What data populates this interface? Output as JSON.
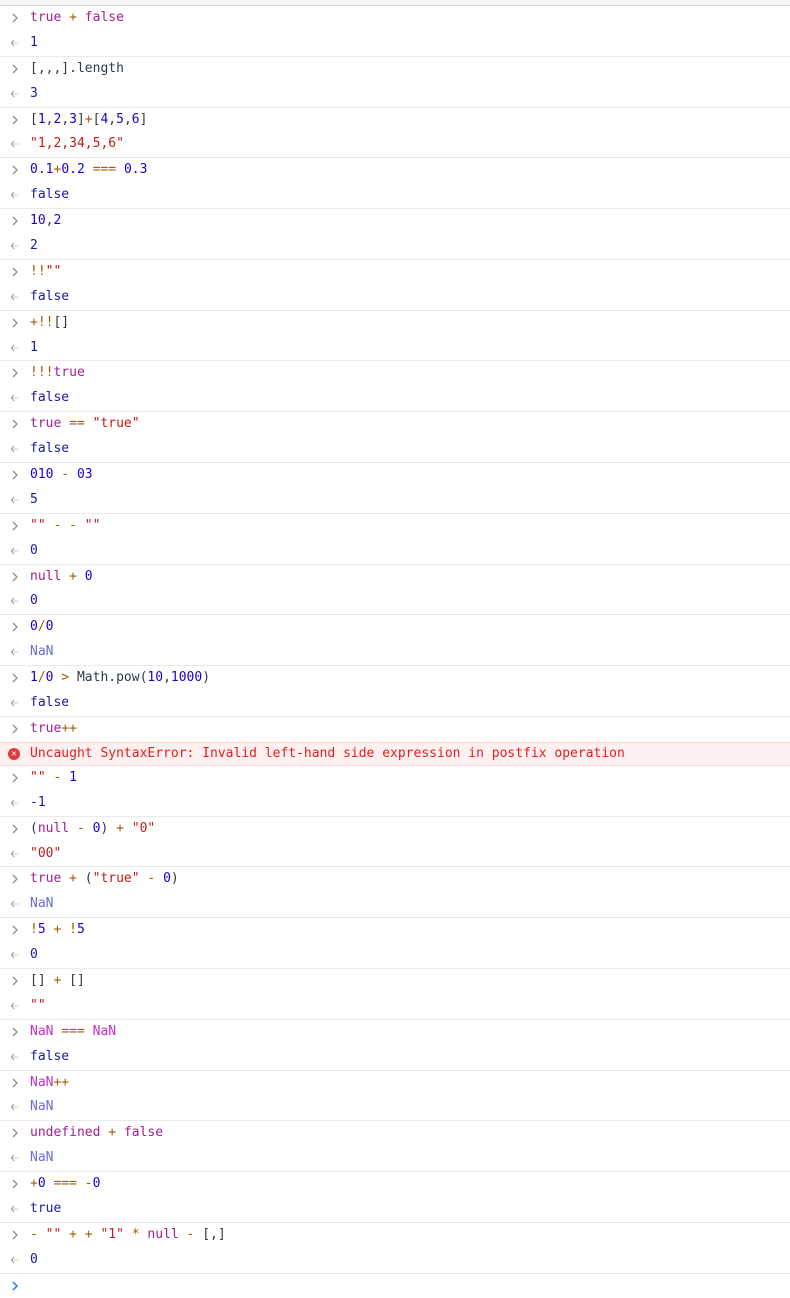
{
  "entries": [
    {
      "input": [
        [
          "kw",
          "true"
        ],
        [
          "op",
          " + "
        ],
        [
          "kw",
          "false"
        ]
      ],
      "result": [
        [
          "res",
          "1"
        ]
      ]
    },
    {
      "input": [
        [
          "ident",
          "[,,,].length"
        ]
      ],
      "result": [
        [
          "res",
          "3"
        ]
      ]
    },
    {
      "input": [
        [
          "ident",
          "["
        ],
        [
          "num",
          "1"
        ],
        [
          "ident",
          ","
        ],
        [
          "num",
          "2"
        ],
        [
          "ident",
          ","
        ],
        [
          "num",
          "3"
        ],
        [
          "ident",
          "]"
        ],
        [
          "op",
          "+"
        ],
        [
          "ident",
          "["
        ],
        [
          "num",
          "4"
        ],
        [
          "ident",
          ","
        ],
        [
          "num",
          "5"
        ],
        [
          "ident",
          ","
        ],
        [
          "num",
          "6"
        ],
        [
          "ident",
          "]"
        ]
      ],
      "result": [
        [
          "res-str",
          "\"1,2,34,5,6\""
        ]
      ]
    },
    {
      "input": [
        [
          "num",
          "0.1"
        ],
        [
          "op",
          "+"
        ],
        [
          "num",
          "0.2"
        ],
        [
          "op",
          " === "
        ],
        [
          "num",
          "0.3"
        ]
      ],
      "result": [
        [
          "res",
          "false"
        ]
      ]
    },
    {
      "input": [
        [
          "num",
          "10"
        ],
        [
          "ident",
          ","
        ],
        [
          "num",
          "2"
        ]
      ],
      "result": [
        [
          "res",
          "2"
        ]
      ]
    },
    {
      "input": [
        [
          "op",
          "!!"
        ],
        [
          "str",
          "\"\""
        ]
      ],
      "result": [
        [
          "res",
          "false"
        ]
      ]
    },
    {
      "input": [
        [
          "op",
          "+!!"
        ],
        [
          "ident",
          "[]"
        ]
      ],
      "result": [
        [
          "res",
          "1"
        ]
      ]
    },
    {
      "input": [
        [
          "op",
          "!!!"
        ],
        [
          "kw",
          "true"
        ]
      ],
      "result": [
        [
          "res",
          "false"
        ]
      ]
    },
    {
      "input": [
        [
          "kw",
          "true"
        ],
        [
          "op",
          " == "
        ],
        [
          "str",
          "\"true\""
        ]
      ],
      "result": [
        [
          "res",
          "false"
        ]
      ]
    },
    {
      "input": [
        [
          "num",
          "010"
        ],
        [
          "op",
          " - "
        ],
        [
          "num",
          "03"
        ]
      ],
      "result": [
        [
          "res",
          "5"
        ]
      ]
    },
    {
      "input": [
        [
          "str",
          "\"\""
        ],
        [
          "op",
          " - - "
        ],
        [
          "str",
          "\"\""
        ]
      ],
      "result": [
        [
          "res",
          "0"
        ]
      ]
    },
    {
      "input": [
        [
          "kw",
          "null"
        ],
        [
          "op",
          " + "
        ],
        [
          "num",
          "0"
        ]
      ],
      "result": [
        [
          "res",
          "0"
        ]
      ]
    },
    {
      "input": [
        [
          "num",
          "0"
        ],
        [
          "op",
          "/"
        ],
        [
          "num",
          "0"
        ]
      ],
      "result": [
        [
          "res-nan",
          "NaN"
        ]
      ]
    },
    {
      "input": [
        [
          "num",
          "1"
        ],
        [
          "op",
          "/"
        ],
        [
          "num",
          "0"
        ],
        [
          "op",
          " > "
        ],
        [
          "ident",
          "Math.pow("
        ],
        [
          "num",
          "10"
        ],
        [
          "ident",
          ","
        ],
        [
          "num",
          "1000"
        ],
        [
          "ident",
          ")"
        ]
      ],
      "result": [
        [
          "res",
          "false"
        ]
      ]
    },
    {
      "input": [
        [
          "kw",
          "true"
        ],
        [
          "op",
          "++"
        ]
      ],
      "error": "Uncaught SyntaxError: Invalid left-hand side expression in postfix operation"
    },
    {
      "input": [
        [
          "str",
          "\"\""
        ],
        [
          "op",
          " - "
        ],
        [
          "num",
          "1"
        ]
      ],
      "result": [
        [
          "res",
          "-1"
        ]
      ]
    },
    {
      "input": [
        [
          "ident",
          "("
        ],
        [
          "kw",
          "null"
        ],
        [
          "op",
          " - "
        ],
        [
          "num",
          "0"
        ],
        [
          "ident",
          ")"
        ],
        [
          "op",
          " + "
        ],
        [
          "str",
          "\"0\""
        ]
      ],
      "result": [
        [
          "res-str",
          "\"00\""
        ]
      ]
    },
    {
      "input": [
        [
          "kw",
          "true"
        ],
        [
          "op",
          " + "
        ],
        [
          "ident",
          "("
        ],
        [
          "str",
          "\"true\""
        ],
        [
          "op",
          " - "
        ],
        [
          "num",
          "0"
        ],
        [
          "ident",
          ")"
        ]
      ],
      "result": [
        [
          "res-nan",
          "NaN"
        ]
      ]
    },
    {
      "input": [
        [
          "op",
          "!"
        ],
        [
          "num",
          "5"
        ],
        [
          "op",
          " + !"
        ],
        [
          "num",
          "5"
        ]
      ],
      "result": [
        [
          "res",
          "0"
        ]
      ]
    },
    {
      "input": [
        [
          "ident",
          "[]"
        ],
        [
          "op",
          " + "
        ],
        [
          "ident",
          "[]"
        ]
      ],
      "result": [
        [
          "res-str",
          "\"\""
        ]
      ]
    },
    {
      "input": [
        [
          "nan",
          "NaN"
        ],
        [
          "op",
          " === "
        ],
        [
          "nan",
          "NaN"
        ]
      ],
      "result": [
        [
          "res",
          "false"
        ]
      ]
    },
    {
      "input": [
        [
          "nan",
          "NaN"
        ],
        [
          "op",
          "++"
        ]
      ],
      "result": [
        [
          "res-nan",
          "NaN"
        ]
      ]
    },
    {
      "input": [
        [
          "kw",
          "undefined"
        ],
        [
          "op",
          " + "
        ],
        [
          "kw",
          "false"
        ]
      ],
      "result": [
        [
          "res-nan",
          "NaN"
        ]
      ]
    },
    {
      "input": [
        [
          "op",
          "+"
        ],
        [
          "num",
          "0"
        ],
        [
          "op",
          " === -"
        ],
        [
          "num",
          "0"
        ]
      ],
      "result": [
        [
          "res",
          "true"
        ]
      ]
    },
    {
      "input": [
        [
          "op",
          "- "
        ],
        [
          "str",
          "\"\""
        ],
        [
          "op",
          " + + "
        ],
        [
          "str",
          "\"1\""
        ],
        [
          "op",
          " * "
        ],
        [
          "kw",
          "null"
        ],
        [
          "op",
          " - "
        ],
        [
          "ident",
          "[,]"
        ]
      ],
      "result": [
        [
          "res",
          "0"
        ]
      ]
    }
  ],
  "icons": {
    "prompt": "chevron-right-icon",
    "result": "return-arrow-icon",
    "error": "error-circle-icon"
  }
}
